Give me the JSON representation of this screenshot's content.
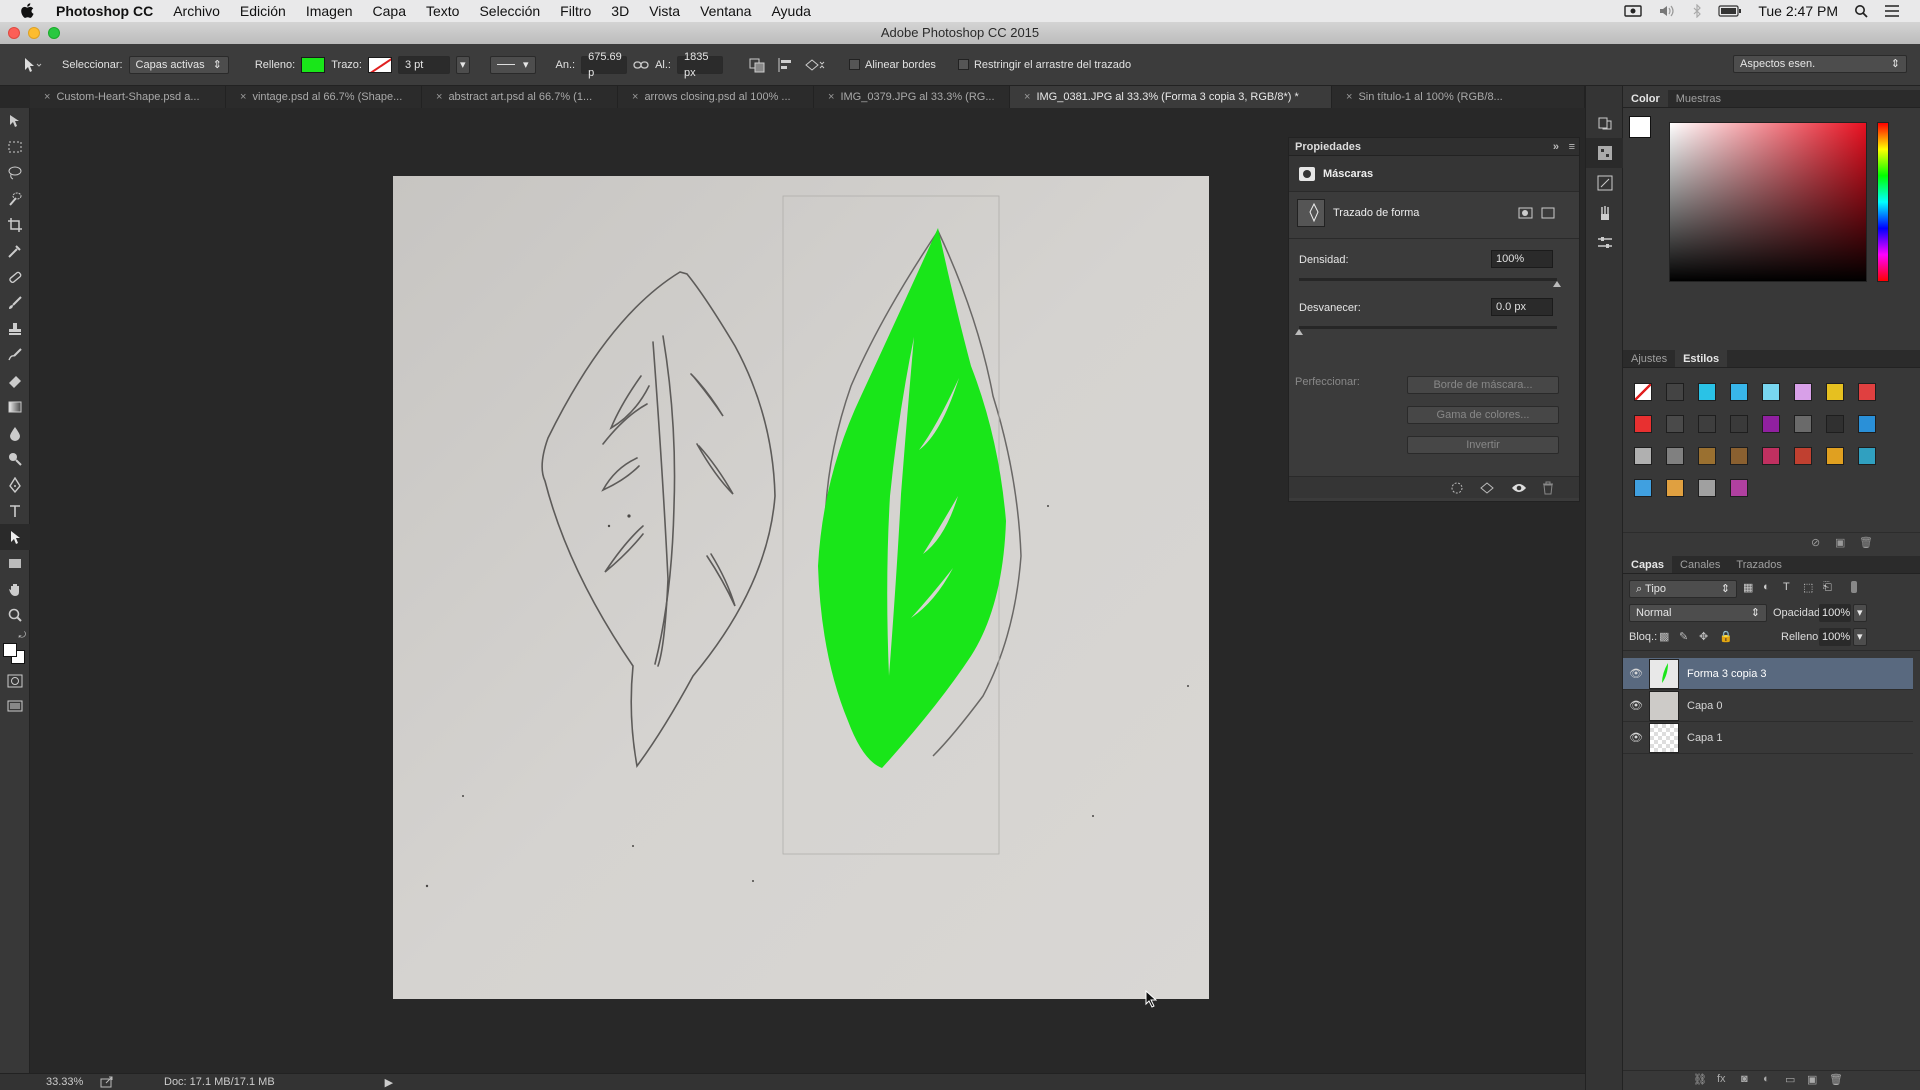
{
  "menubar": {
    "app_name": "Photoshop CC",
    "items": [
      "Archivo",
      "Edición",
      "Imagen",
      "Capa",
      "Texto",
      "Selección",
      "Filtro",
      "3D",
      "Vista",
      "Ventana",
      "Ayuda"
    ],
    "clock": "Tue 2:47 PM"
  },
  "window": {
    "title": "Adobe Photoshop CC 2015"
  },
  "options": {
    "select_label": "Seleccionar:",
    "select_value": "Capas activas",
    "fill_label": "Relleno:",
    "fill_color": "#19e619",
    "stroke_label": "Trazo:",
    "stroke_width": "3 pt",
    "width_label": "An.:",
    "width_value": "675.69 p",
    "height_label": "Al.:",
    "height_value": "1835 px",
    "align_edges": "Alinear bordes",
    "constrain_path": "Restringir el arrastre del trazado",
    "workspace": "Aspectos esen."
  },
  "tabs": [
    {
      "label": "Custom-Heart-Shape.psd a...",
      "active": false
    },
    {
      "label": "vintage.psd al 66.7% (Shape...",
      "active": false
    },
    {
      "label": "abstract art.psd al 66.7% (1...",
      "active": false
    },
    {
      "label": "arrows closing.psd al 100% ...",
      "active": false
    },
    {
      "label": "IMG_0379.JPG al 33.3% (RG...",
      "active": false
    },
    {
      "label": "IMG_0381.JPG al 33.3% (Forma 3 copia 3, RGB/8*) *",
      "active": true
    },
    {
      "label": "Sin título-1 al 100% (RGB/8...",
      "active": false
    }
  ],
  "status": {
    "zoom": "33.33%",
    "doc": "Doc: 17.1 MB/17.1 MB"
  },
  "properties": {
    "title": "Propiedades",
    "section": "Máscaras",
    "mask_type": "Trazado de forma",
    "density_label": "Densidad:",
    "density_value": "100%",
    "density_level": 1.0,
    "feather_label": "Desvanecer:",
    "feather_value": "0.0 px",
    "feather_level": 0.0,
    "refine_label": "Perfeccionar:",
    "btn_mask_edge": "Borde de máscara...",
    "btn_color_range": "Gama de colores...",
    "btn_invert": "Invertir"
  },
  "color_panel": {
    "tabs": [
      "Color",
      "Muestras"
    ],
    "active": 0
  },
  "styles_panel": {
    "tabs": [
      "Ajustes",
      "Estilos"
    ],
    "active": 1,
    "swatches": [
      "#ffffff",
      "#444444",
      "#2ac2e6",
      "#38b6ea",
      "#78d6f0",
      "#d8a0e8",
      "#e6c020",
      "#e04040",
      "#e83030",
      "#4a4a4a",
      "#3e3e3e",
      "#3a3a3a",
      "#9020a0",
      "#6a6a6a",
      "#303030",
      "#2a90d8",
      "#b0b0b0",
      "#808080",
      "#9a7030",
      "#8a6030",
      "#c03060",
      "#c04030",
      "#e0a020",
      "#30a0c0",
      "#40a0e0",
      "#e0a040",
      "#a0a0a0",
      "#b040a0"
    ]
  },
  "layers_panel": {
    "tabs": [
      "Capas",
      "Canales",
      "Trazados"
    ],
    "active": 0,
    "filter": "Tipo",
    "blend_mode": "Normal",
    "opacity_label": "Opacidad:",
    "opacity_value": "100%",
    "lock_label": "Bloq.:",
    "fill_label": "Relleno:",
    "fill_value": "100%",
    "layers": [
      {
        "name": "Forma 3 copia 3",
        "selected": true
      },
      {
        "name": "Capa 0",
        "selected": false
      },
      {
        "name": "Capa 1",
        "selected": false
      }
    ]
  }
}
